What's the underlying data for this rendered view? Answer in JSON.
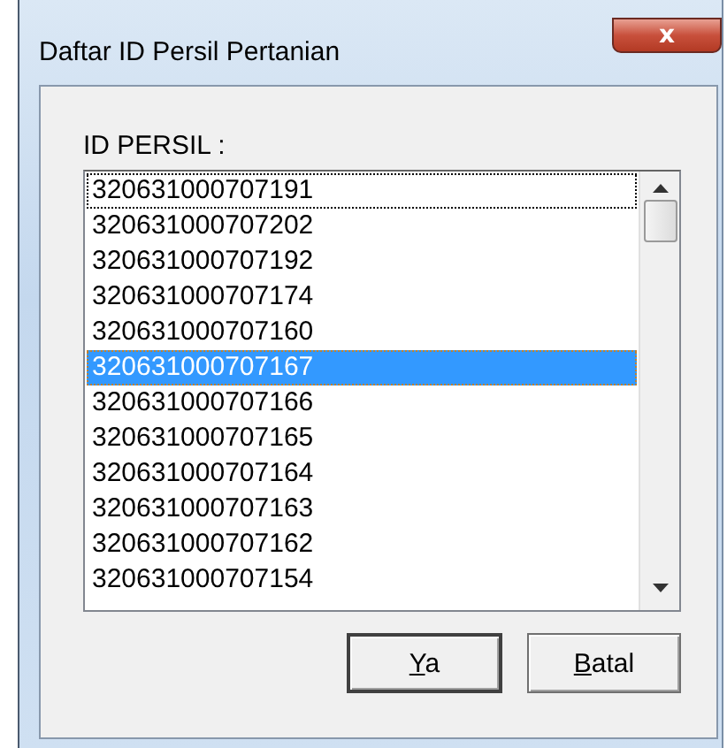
{
  "window": {
    "title": "Daftar ID Persil Pertanian",
    "close": "x"
  },
  "list": {
    "label": "ID PERSIL :",
    "items": [
      {
        "text": "320631000707191",
        "selected": false,
        "focused": true
      },
      {
        "text": "320631000707202",
        "selected": false,
        "focused": false
      },
      {
        "text": "320631000707192",
        "selected": false,
        "focused": false
      },
      {
        "text": "320631000707174",
        "selected": false,
        "focused": false
      },
      {
        "text": "320631000707160",
        "selected": false,
        "focused": false
      },
      {
        "text": "320631000707167",
        "selected": true,
        "focused": false
      },
      {
        "text": "320631000707166",
        "selected": false,
        "focused": false
      },
      {
        "text": "320631000707165",
        "selected": false,
        "focused": false
      },
      {
        "text": "320631000707164",
        "selected": false,
        "focused": false
      },
      {
        "text": "320631000707163",
        "selected": false,
        "focused": false
      },
      {
        "text": "320631000707162",
        "selected": false,
        "focused": false
      },
      {
        "text": "320631000707154",
        "selected": false,
        "focused": false
      }
    ]
  },
  "buttons": [
    {
      "label": "Ya",
      "underline_first": true,
      "default": true
    },
    {
      "label": "Batal",
      "underline_first": true,
      "default": false
    }
  ]
}
